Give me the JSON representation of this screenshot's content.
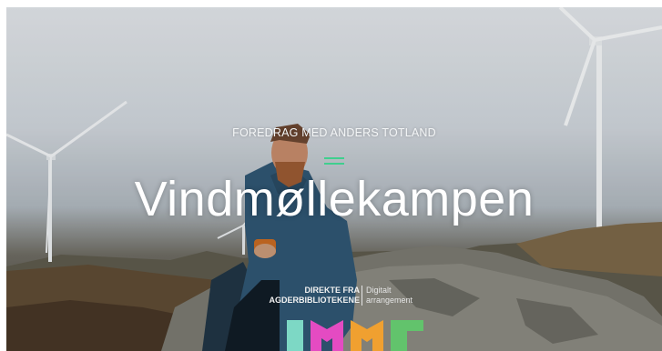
{
  "hero": {
    "kicker": "FOREDRAG MED ANDERS TOTLAND",
    "title": "Vindmøllekampen",
    "accent_color": "#3fcf8e",
    "event_info": {
      "left_line1": "DIREKTE FRA",
      "left_line2": "AGDERBIBLIOTEKENE",
      "right_line1": "Digitalt",
      "right_line2": "arrangement"
    },
    "logo": {
      "colors": [
        "#7dd8c5",
        "#e44bc2",
        "#f0a030",
        "#62c36c"
      ]
    }
  }
}
